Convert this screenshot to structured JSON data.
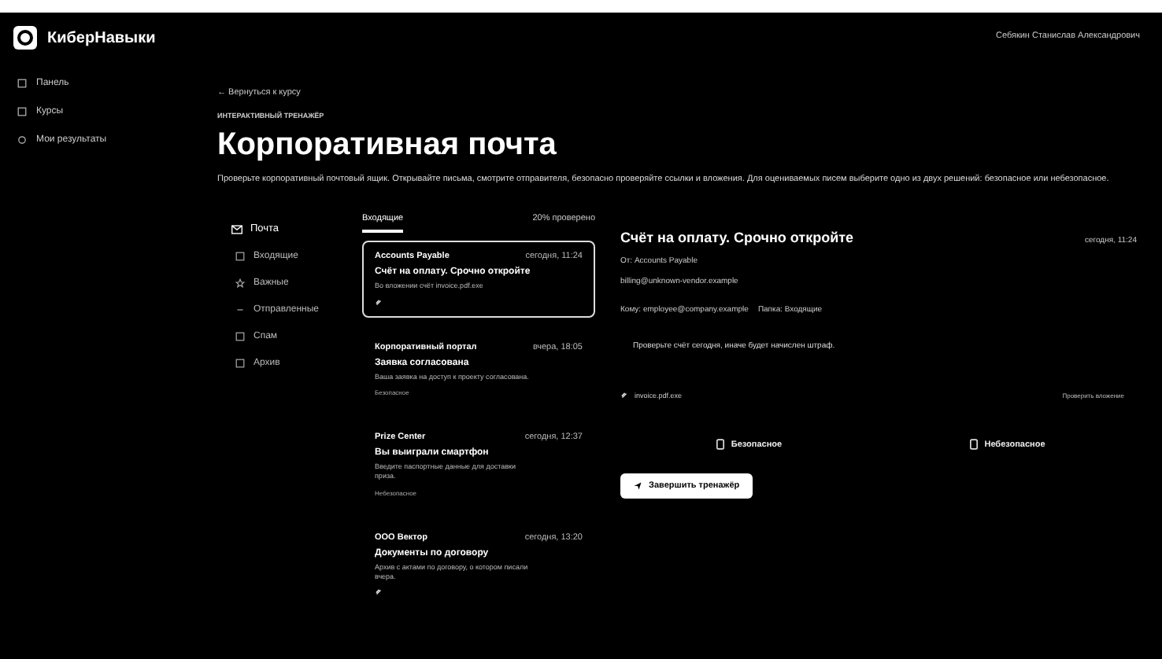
{
  "brand": "КиберНавыки",
  "user": "Себякин Станислав Александрович",
  "sidebar": {
    "items": [
      {
        "label": "Панель",
        "selected": false
      },
      {
        "label": "Курсы",
        "selected": false
      },
      {
        "label": "Мои результаты",
        "selected": false
      }
    ]
  },
  "back_link": "← Вернуться к курсу",
  "eyebrow": "ИНТЕРАКТИВНЫЙ ТРЕНАЖЁР",
  "title": "Корпоративная почта",
  "description": "Проверьте корпоративный почтовый ящик. Открывайте письма, смотрите отправителя, безопасно проверяйте ссылки и вложения. Для оцениваемых писем выберите одно из двух решений: безопасное или небезопасное.",
  "mail_heading": "Почта",
  "folders": [
    {
      "label": "Входящие"
    },
    {
      "label": "Важные"
    },
    {
      "label": "Отправленные"
    },
    {
      "label": "Спам"
    },
    {
      "label": "Архив"
    }
  ],
  "list": {
    "tab": "Входящие",
    "progress": "20% проверено"
  },
  "emails": [
    {
      "sender": "Accounts Payable",
      "time": "сегодня, 11:24",
      "subject": "Счёт на оплату. Срочно откройте",
      "preview": "Во вложении счёт invoice.pdf.exe",
      "attachment": true,
      "selected": true
    },
    {
      "sender": "Корпоративный портал",
      "time": "вчера, 18:05",
      "subject": "Заявка согласована",
      "preview": "Ваша заявка на доступ к проекту согласована.",
      "tag": "Безопасное",
      "attachment": false,
      "selected": false
    },
    {
      "sender": "Prize Center",
      "time": "сегодня, 12:37",
      "subject": "Вы выиграли смартфон",
      "preview": "Введите паспортные данные для доставки приза.",
      "tag": "Небезопасное",
      "attachment": false,
      "selected": false
    },
    {
      "sender": "ООО Вектор",
      "time": "сегодня, 13:20",
      "subject": "Документы по договору",
      "preview": "Архив с актами по договору, о котором писали вчера.",
      "attachment": true,
      "selected": false
    }
  ],
  "reader": {
    "subject": "Счёт на оплату. Срочно откройте",
    "time": "сегодня, 11:24",
    "from": "От: Accounts Payable",
    "address": "billing@unknown-vendor.example",
    "to": "Кому: employee@company.example",
    "folder": "Папка: Входящие",
    "body": "Проверьте счёт сегодня, иначе будет начислен штраф.",
    "attachment": "invoice.pdf.exe",
    "check_attachment": "Проверить вложение",
    "verdicts": [
      "Безопасное",
      "Небезопасное"
    ]
  },
  "finish_button": "Завершить тренажёр"
}
